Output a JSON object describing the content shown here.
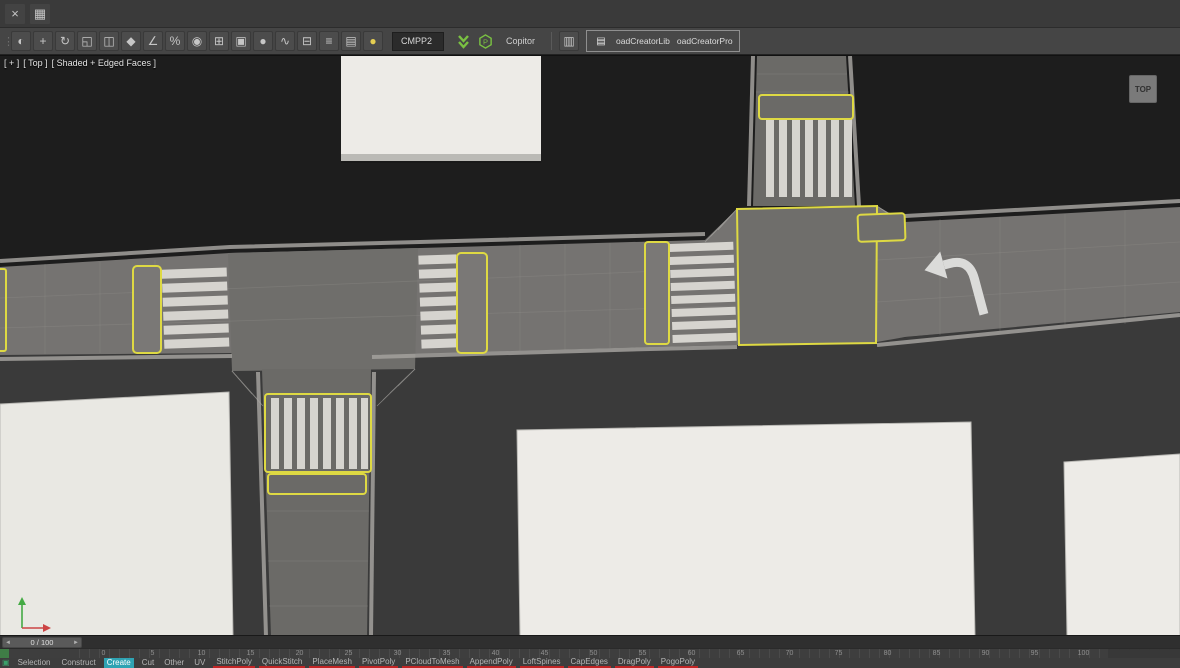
{
  "toolbar1": {
    "icons": [
      {
        "name": "customize-icon",
        "glyph": "×"
      },
      {
        "name": "window-grid-icon",
        "glyph": "▦"
      }
    ]
  },
  "toolbar2": {
    "icons": [
      {
        "name": "select-icon",
        "glyph": "◐"
      },
      {
        "name": "move-icon",
        "glyph": "+"
      },
      {
        "name": "rotate-icon",
        "glyph": "↻"
      },
      {
        "name": "scale-icon",
        "glyph": "◱"
      },
      {
        "name": "mirror-icon",
        "glyph": "◫"
      },
      {
        "name": "snap-toggle-icon",
        "glyph": "◆"
      },
      {
        "name": "angle-snap-icon",
        "glyph": "∠"
      },
      {
        "name": "percent-snap-icon",
        "glyph": "%"
      },
      {
        "name": "material-editor-icon",
        "glyph": "◉"
      },
      {
        "name": "render-setup-icon",
        "glyph": "⊞"
      },
      {
        "name": "render-frame-icon",
        "glyph": "▣"
      },
      {
        "name": "render-icon",
        "glyph": "●"
      },
      {
        "name": "curve-editor-icon",
        "glyph": "∿"
      },
      {
        "name": "schematic-view-icon",
        "glyph": "⊟"
      },
      {
        "name": "layer-manager-icon",
        "glyph": "≡"
      },
      {
        "name": "ribbon-toggle-icon",
        "glyph": "▤"
      },
      {
        "name": "light-toggle-icon",
        "glyph": "●",
        "color": "#e5ce52"
      }
    ],
    "preset_dropdown": "CMPP2",
    "copitor_label": "Copitor",
    "plugin_lib_label": "oadCreatorLib",
    "plugin_pro_label": "oadCreatorPro"
  },
  "viewport": {
    "label_plus": "[ + ]",
    "label_view": "[ Top ]",
    "label_shading": "[ Shaded + Edged Faces ]",
    "viewcube_label": "TOP"
  },
  "timeline": {
    "slider_label": "0 / 100",
    "ticks": [
      "0",
      "5",
      "10",
      "15",
      "20",
      "25",
      "30",
      "35",
      "40",
      "45",
      "50",
      "55",
      "60",
      "65",
      "70",
      "75",
      "80",
      "85",
      "90",
      "95",
      "100"
    ]
  },
  "statusbar": {
    "left_labels": [
      "Selection",
      "Construct"
    ],
    "active_chip": "Create",
    "plain_chips": [
      "Cut",
      "Other",
      "UV"
    ],
    "tool_chips": [
      "StitchPoly",
      "QuickStitch",
      "PlaceMesh",
      "PivotPoly",
      "PCloudToMesh",
      "AppendPoly",
      "LoftSpines",
      "CapEdges",
      "DragPoly",
      "PogoPoly"
    ]
  },
  "colors": {
    "selection_yellow": "#ded943",
    "accent_green": "#7ac142",
    "active_teal": "#2fa3b3",
    "road_gray": "#757371",
    "building_light": "#edebe7",
    "arrow_white": "#dbdbd9"
  }
}
